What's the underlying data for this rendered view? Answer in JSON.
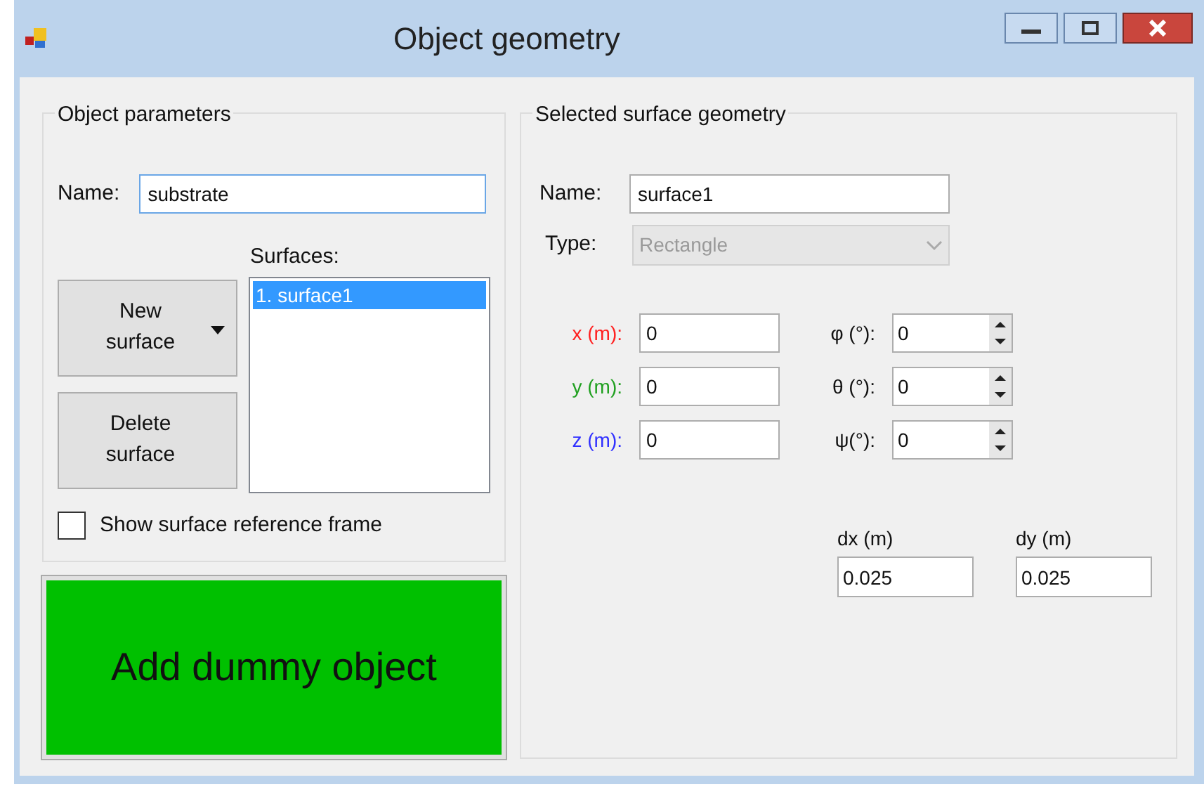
{
  "window": {
    "title": "Object geometry"
  },
  "object_parameters": {
    "title": "Object parameters",
    "name_label": "Name:",
    "name_value": "substrate",
    "surfaces_label": "Surfaces:",
    "buttons": [
      {
        "label": "New\nsurface",
        "kind": "dropdown"
      },
      {
        "label": "Delete\nsurface",
        "kind": "plain"
      }
    ],
    "surfaces": [
      {
        "label": "1. surface1",
        "selected": true
      }
    ],
    "show_frame": {
      "label": "Show surface reference frame",
      "checked": false
    }
  },
  "add_button": {
    "label": "Add dummy object"
  },
  "surface_geometry": {
    "title": "Selected surface geometry",
    "name_label": "Name:",
    "name_value": "surface1",
    "type_label": "Type:",
    "type_value": "Rectangle",
    "type_disabled": true,
    "positions": [
      {
        "label": "x (m):",
        "value": "0",
        "color": "#ff2020"
      },
      {
        "label": "y (m):",
        "value": "0",
        "color": "#20a020"
      },
      {
        "label": "z (m):",
        "value": "0",
        "color": "#3030ff"
      }
    ],
    "angles": [
      {
        "label": "φ (°):",
        "value": "0"
      },
      {
        "label": "θ (°):",
        "value": "0"
      },
      {
        "label": "ψ(°):",
        "value": "0"
      }
    ],
    "sizes": [
      {
        "label": "dx (m)",
        "value": "0.025"
      },
      {
        "label": "dy (m)",
        "value": "0.025"
      }
    ]
  }
}
